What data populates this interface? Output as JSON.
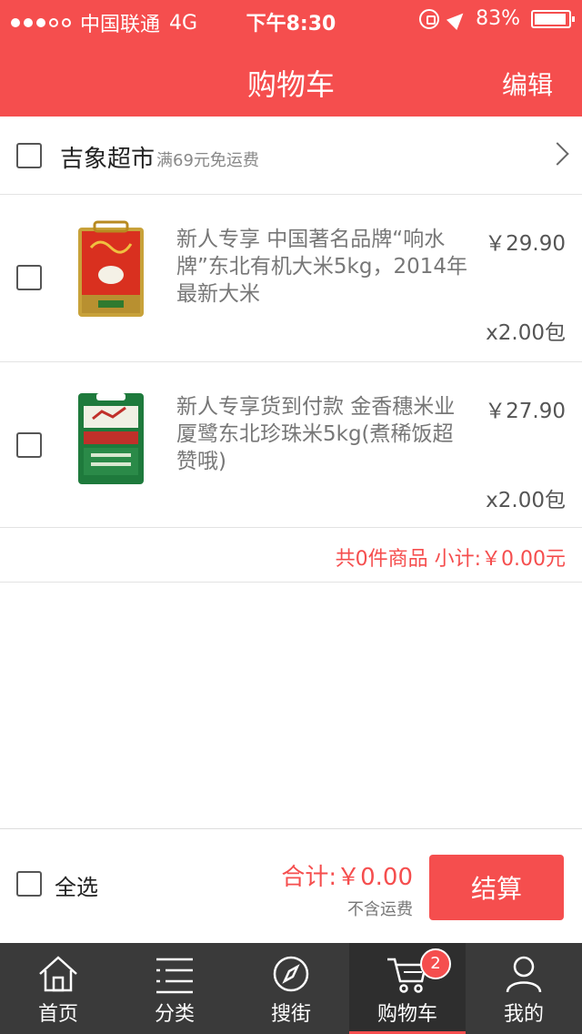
{
  "status_bar": {
    "carrier": "中国联通",
    "network": "4G",
    "time": "下午8:30",
    "battery": "83%"
  },
  "nav": {
    "title": "购物车",
    "edit_label": "编辑"
  },
  "shop": {
    "name": "吉象超市",
    "shipping_note": "满69元免运费"
  },
  "items": [
    {
      "title": "新人专享 中国著名品牌“响水牌”东北有机大米5kg，2014年最新大米",
      "price": "￥29.90",
      "quantity": "x2.00包"
    },
    {
      "title": "新人专享货到付款 金香穗米业厦鹭东北珍珠米5kg(煮稀饭超赞哦)",
      "price": "￥27.90",
      "quantity": "x2.00包"
    }
  ],
  "subtotal": "共0件商品 小计:￥0.00元",
  "checkout": {
    "select_all": "全选",
    "total": "合计:￥0.00",
    "shipping_note": "不含运费",
    "pay_label": "结算"
  },
  "tabs": [
    {
      "label": "首页",
      "icon": "home-icon"
    },
    {
      "label": "分类",
      "icon": "list-icon"
    },
    {
      "label": "搜街",
      "icon": "compass-icon"
    },
    {
      "label": "购物车",
      "icon": "cart-icon",
      "active": true,
      "badge": "2"
    },
    {
      "label": "我的",
      "icon": "user-icon"
    }
  ],
  "colors": {
    "accent": "#f54e4e",
    "tabbar": "#3a3a3a"
  }
}
